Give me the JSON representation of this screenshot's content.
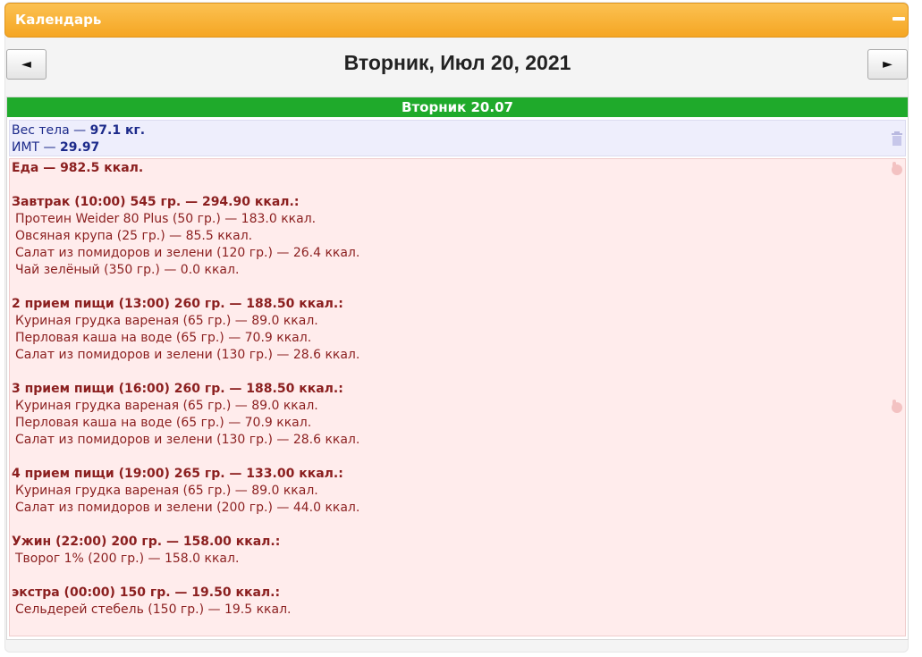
{
  "calendar": {
    "title": "Календарь",
    "date_title": "Вторник, Июл 20, 2021",
    "prev_label": "◄",
    "next_label": "►"
  },
  "day": {
    "header": "Вторник 20.07",
    "body": {
      "weight_label": "Вес тела — ",
      "weight_value": "97.1 кг.",
      "bmi_label": "ИМТ — ",
      "bmi_value": "29.97"
    },
    "food_total": "Еда — 982.5 ккал.",
    "meals": [
      {
        "heading": "Завтрак (10:00) 545 гр. — 294.90 ккал.:",
        "items": [
          "Протеин Weider 80 Plus (50 гр.) — 183.0 ккал.",
          "Овсяная крупа (25 гр.) — 85.5 ккал.",
          "Салат из помидоров и зелени (120 гр.) — 26.4 ккал.",
          "Чай зелёный (350 гр.) — 0.0 ккал."
        ]
      },
      {
        "heading": "2 прием пищи (13:00) 260 гр. — 188.50 ккал.:",
        "items": [
          "Куриная грудка вареная (65 гр.) — 89.0 ккал.",
          "Перловая каша на воде (65 гр.) — 70.9 ккал.",
          "Салат из помидоров и зелени (130 гр.) — 28.6 ккал."
        ]
      },
      {
        "heading": "3 прием пищи (16:00) 260 гр. — 188.50 ккал.:",
        "items": [
          "Куриная грудка вареная (65 гр.) — 89.0 ккал.",
          "Перловая каша на воде (65 гр.) — 70.9 ккал.",
          "Салат из помидоров и зелени (130 гр.) — 28.6 ккал."
        ]
      },
      {
        "heading": "4 прием пищи (19:00) 265 гр. — 133.00 ккал.:",
        "items": [
          "Куриная грудка вареная (65 гр.) — 89.0 ккал.",
          "Салат из помидоров и зелени (200 гр.) — 44.0 ккал."
        ]
      },
      {
        "heading": "Ужин (22:00) 200 гр. — 158.00 ккал.:",
        "items": [
          "Творог 1% (200 гр.) — 158.0 ккал."
        ]
      },
      {
        "heading": "экстра (00:00) 150 гр. — 19.50 ккал.:",
        "items": [
          "Сельдерей стебель (150 гр.) — 19.5 ккал."
        ]
      }
    ]
  },
  "icons": {
    "collapse": "minus-icon",
    "body_action": "trash-icon",
    "food_action": "hand-pointer-icon"
  },
  "colors": {
    "titlebar": "#f5a623",
    "day_header": "#1faa2b",
    "body_bg": "#eeeefc",
    "body_text": "#1c2a8a",
    "food_bg": "#ffecec",
    "food_text": "#8b1f1f"
  }
}
